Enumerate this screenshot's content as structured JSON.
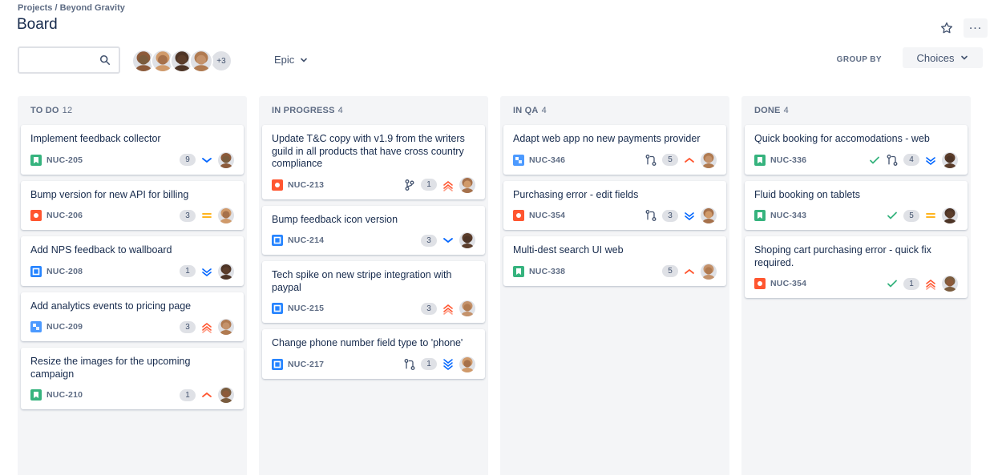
{
  "breadcrumb": "Projects / Beyond Gravity",
  "title": "Board",
  "toolbar": {
    "search_placeholder": "",
    "more_avatars": "+3",
    "epic_label": "Epic",
    "group_by_label": "GROUP BY",
    "group_by_value": "Choices"
  },
  "colors": {
    "story": "#36b37e",
    "bug": "#ff5630",
    "task": "#2684ff",
    "subtask": "#4c9aff",
    "priority_high": "#ff5630",
    "priority_low": "#0065ff",
    "priority_medium": "#ffab00",
    "done_check": "#36b37e"
  },
  "avatar_colors": [
    "#7a5c3e",
    "#a6714b",
    "#5b3d2b",
    "#c4926b",
    "#8c5a3a",
    "#d09a6a",
    "#4d3426",
    "#b07a50"
  ],
  "columns": [
    {
      "name": "TO DO",
      "count": "12",
      "cards": [
        {
          "title": "Implement feedback collector",
          "key": "NUC-205",
          "type": "story",
          "estimate": "9",
          "priority": "low",
          "avatar": 0
        },
        {
          "title": "Bump version for new API for billing",
          "key": "NUC-206",
          "type": "bug",
          "estimate": "3",
          "priority": "medium",
          "avatar": 1
        },
        {
          "title": "Add NPS feedback to wallboard",
          "key": "NUC-208",
          "type": "task",
          "estimate": "1",
          "priority": "lowest",
          "avatar": 2
        },
        {
          "title": "Add analytics events to pricing page",
          "key": "NUC-209",
          "type": "subtask",
          "estimate": "3",
          "priority": "highest",
          "avatar": 3
        },
        {
          "title": "Resize the images for the upcoming campaign",
          "key": "NUC-210",
          "type": "story",
          "estimate": "1",
          "priority": "high",
          "avatar": 4
        }
      ]
    },
    {
      "name": "IN PROGRESS",
      "count": "4",
      "cards": [
        {
          "title": "Update T&C copy with v1.9 from the writers guild in all products that have cross country compliance",
          "key": "NUC-213",
          "type": "bug",
          "branch": true,
          "estimate": "1",
          "priority": "highest",
          "avatar": 5
        },
        {
          "title": "Bump feedback icon version",
          "key": "NUC-214",
          "type": "task",
          "estimate": "3",
          "priority": "low",
          "avatar": 6
        },
        {
          "title": "Tech spike on new stripe integration with paypal",
          "key": "NUC-215",
          "type": "task",
          "estimate": "3",
          "priority": "highest",
          "avatar": 7
        },
        {
          "title": "Change phone number field type to 'phone'",
          "key": "NUC-217",
          "type": "task",
          "pr": true,
          "estimate": "1",
          "priority": "lowest-triple",
          "avatar": 1
        }
      ]
    },
    {
      "name": "IN QA",
      "count": "4",
      "cards": [
        {
          "title": "Adapt web app no new payments provider",
          "key": "NUC-346",
          "type": "subtask",
          "pr": true,
          "estimate": "5",
          "priority": "high",
          "avatar": 3
        },
        {
          "title": "Purchasing error - edit fields",
          "key": "NUC-354",
          "type": "bug",
          "pr": true,
          "estimate": "3",
          "priority": "lowest",
          "avatar": 5
        },
        {
          "title": "Multi-dest search UI web",
          "key": "NUC-338",
          "type": "story",
          "estimate": "5",
          "priority": "high",
          "avatar": 7
        }
      ]
    },
    {
      "name": "DONE",
      "count": "4",
      "cards": [
        {
          "title": "Quick booking for accomodations - web",
          "key": "NUC-336",
          "type": "story",
          "done": true,
          "pr": true,
          "estimate": "4",
          "priority": "lowest",
          "avatar": 6
        },
        {
          "title": "Fluid booking on tablets",
          "key": "NUC-343",
          "type": "story",
          "done": true,
          "estimate": "5",
          "priority": "medium",
          "avatar": 2
        },
        {
          "title": "Shoping cart purchasing error - quick fix required.",
          "key": "NUC-354",
          "type": "bug",
          "done": true,
          "estimate": "1",
          "priority": "highest",
          "avatar": 4
        }
      ]
    }
  ]
}
